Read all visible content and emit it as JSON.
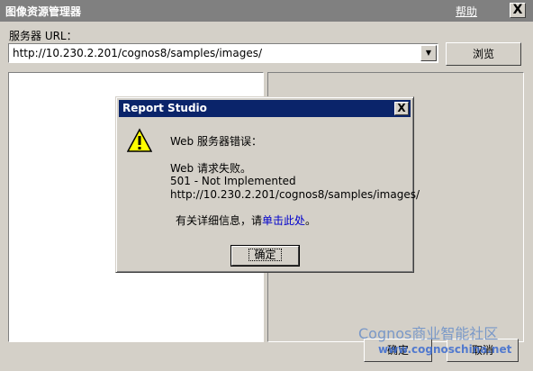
{
  "window": {
    "title": "图像资源管理器",
    "help_label": "帮助",
    "close_label": "X"
  },
  "url_field": {
    "label": "服务器 URL：",
    "value": "http://10.230.2.201/cognos8/samples/images/"
  },
  "buttons": {
    "browse": "浏览",
    "ok": "确定",
    "cancel": "取消"
  },
  "dialog": {
    "title": "Report Studio",
    "close_label": "X",
    "heading": "Web 服务器错误：",
    "line1": "Web 请求失败。",
    "line2": "501 - Not Implemented",
    "line3": "http://10.230.2.201/cognos8/samples/images/",
    "more_info_prefix": "有关详细信息，请",
    "more_info_link": "单击此处",
    "more_info_suffix": "。",
    "ok_label": "确定"
  },
  "watermark": {
    "line1": "Cognos商业智能社区",
    "line2": "www.cognoschina.net"
  },
  "icons": {
    "dialog_icon": "warning-icon",
    "dropdown_icon": "chevron-down-icon"
  }
}
